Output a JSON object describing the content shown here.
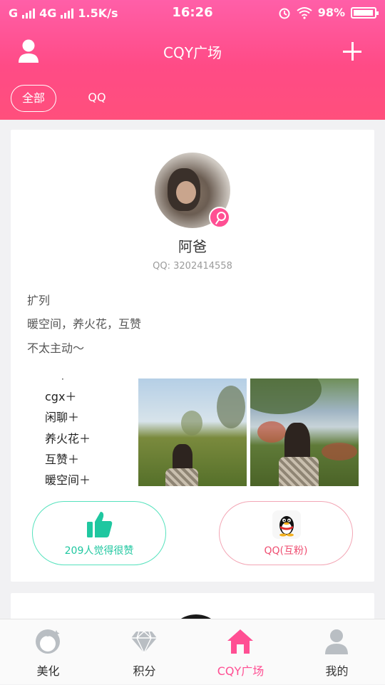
{
  "status_bar": {
    "carrier1": "G",
    "carrier2": "4G",
    "speed": "1.5K/s",
    "time": "16:26",
    "battery": "98%"
  },
  "nav": {
    "title": "CQY广场",
    "profile_icon": "person-icon",
    "add_icon": "plus-icon"
  },
  "tabs": [
    {
      "label": "全部",
      "active": true
    },
    {
      "label": "QQ",
      "active": false
    }
  ],
  "post": {
    "username": "阿爸",
    "qq": "QQ: 3202414558",
    "gender_icon": "female-icon",
    "bio_lines": [
      "扩列",
      "暖空间，养火花，互赞",
      "不太主动～"
    ],
    "photo_text_lines": [
      "cgx＋",
      "闲聊＋",
      "养火花＋",
      "互赞＋",
      "暖空间＋"
    ],
    "like_label": "209人觉得很赞",
    "qq_label": "QQ(互粉)"
  },
  "tabbar": [
    {
      "label": "美化",
      "icon": "beauty-face-icon",
      "active": false
    },
    {
      "label": "积分",
      "icon": "diamond-icon",
      "active": false
    },
    {
      "label": "CQY广场",
      "icon": "home-icon",
      "active": true
    },
    {
      "label": "我的",
      "icon": "user-icon",
      "active": false
    }
  ],
  "colors": {
    "header_top": "#ff5fa8",
    "header_bottom": "#ff4f7c",
    "accent_pink": "#ff4f93",
    "like_green": "#1fc7a0",
    "qq_red": "#ef4f72"
  }
}
